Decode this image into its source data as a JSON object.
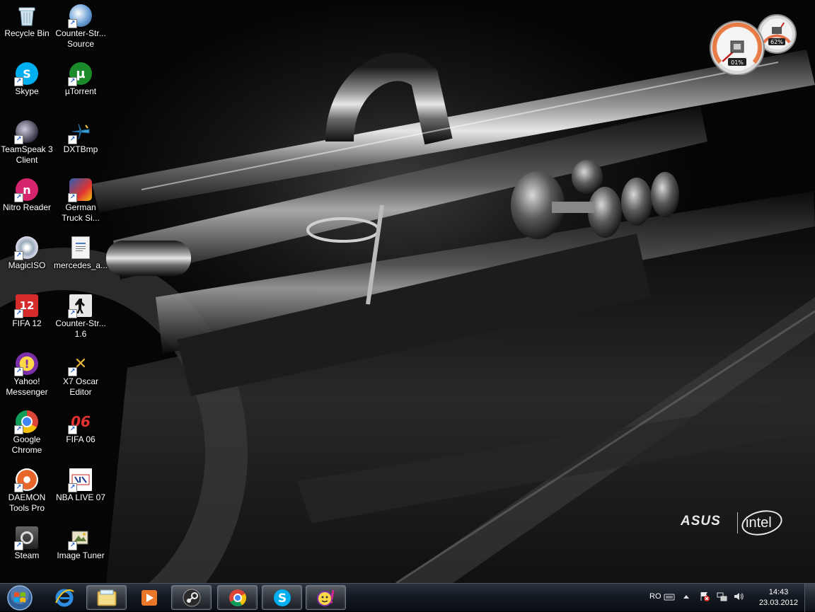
{
  "desktop": {
    "icons": [
      {
        "label": "Recycle Bin"
      },
      {
        "label": "Counter-Str...\nSource"
      },
      {
        "label": "Skype"
      },
      {
        "label": "µTorrent"
      },
      {
        "label": "TeamSpeak 3\nClient"
      },
      {
        "label": "DXTBmp"
      },
      {
        "label": "Nitro Reader"
      },
      {
        "label": "German\nTruck Si..."
      },
      {
        "label": "MagicISO"
      },
      {
        "label": "mercedes_a..."
      },
      {
        "label": "FIFA 12"
      },
      {
        "label": "Counter-Str...\n1.6"
      },
      {
        "label": "Yahoo!\nMessenger"
      },
      {
        "label": "X7 Oscar\nEditor"
      },
      {
        "label": "Google\nChrome"
      },
      {
        "label": "FIFA 06"
      },
      {
        "label": "DAEMON\nTools Pro"
      },
      {
        "label": "NBA LIVE 07"
      },
      {
        "label": "Steam"
      },
      {
        "label": "Image Tuner"
      }
    ]
  },
  "gadget": {
    "cpu_text": "01%",
    "cpu_level": 0.01,
    "memory_text": "62%",
    "memory_level": 0.62
  },
  "brand": {
    "left": "ASUS",
    "right": "intel"
  },
  "taskbar": {
    "pinned": [
      {
        "name": "internet-explorer",
        "icon": "ie-icon"
      },
      {
        "name": "windows-explorer",
        "icon": "folder-icon"
      },
      {
        "name": "media-player",
        "icon": "media-player-icon"
      },
      {
        "name": "steam",
        "icon": "steam-icon"
      },
      {
        "name": "chrome",
        "icon": "chrome-icon"
      },
      {
        "name": "skype",
        "icon": "skype-icon"
      },
      {
        "name": "yahoo-messenger",
        "icon": "yahoo-icon"
      }
    ],
    "tray": {
      "language": "RO",
      "time": "14:43",
      "date": "23.03.2012"
    }
  },
  "colors": {
    "taskbar": "#141a22",
    "skype": "#00aff0",
    "utorrent": "#1a8a2a",
    "nitro": "#d6246e",
    "fifa12": "#d62b2b",
    "chrome_red": "#db4437",
    "chrome_yellow": "#f4c20d",
    "chrome_green": "#0f9d58",
    "chrome_blue": "#4285f4"
  }
}
